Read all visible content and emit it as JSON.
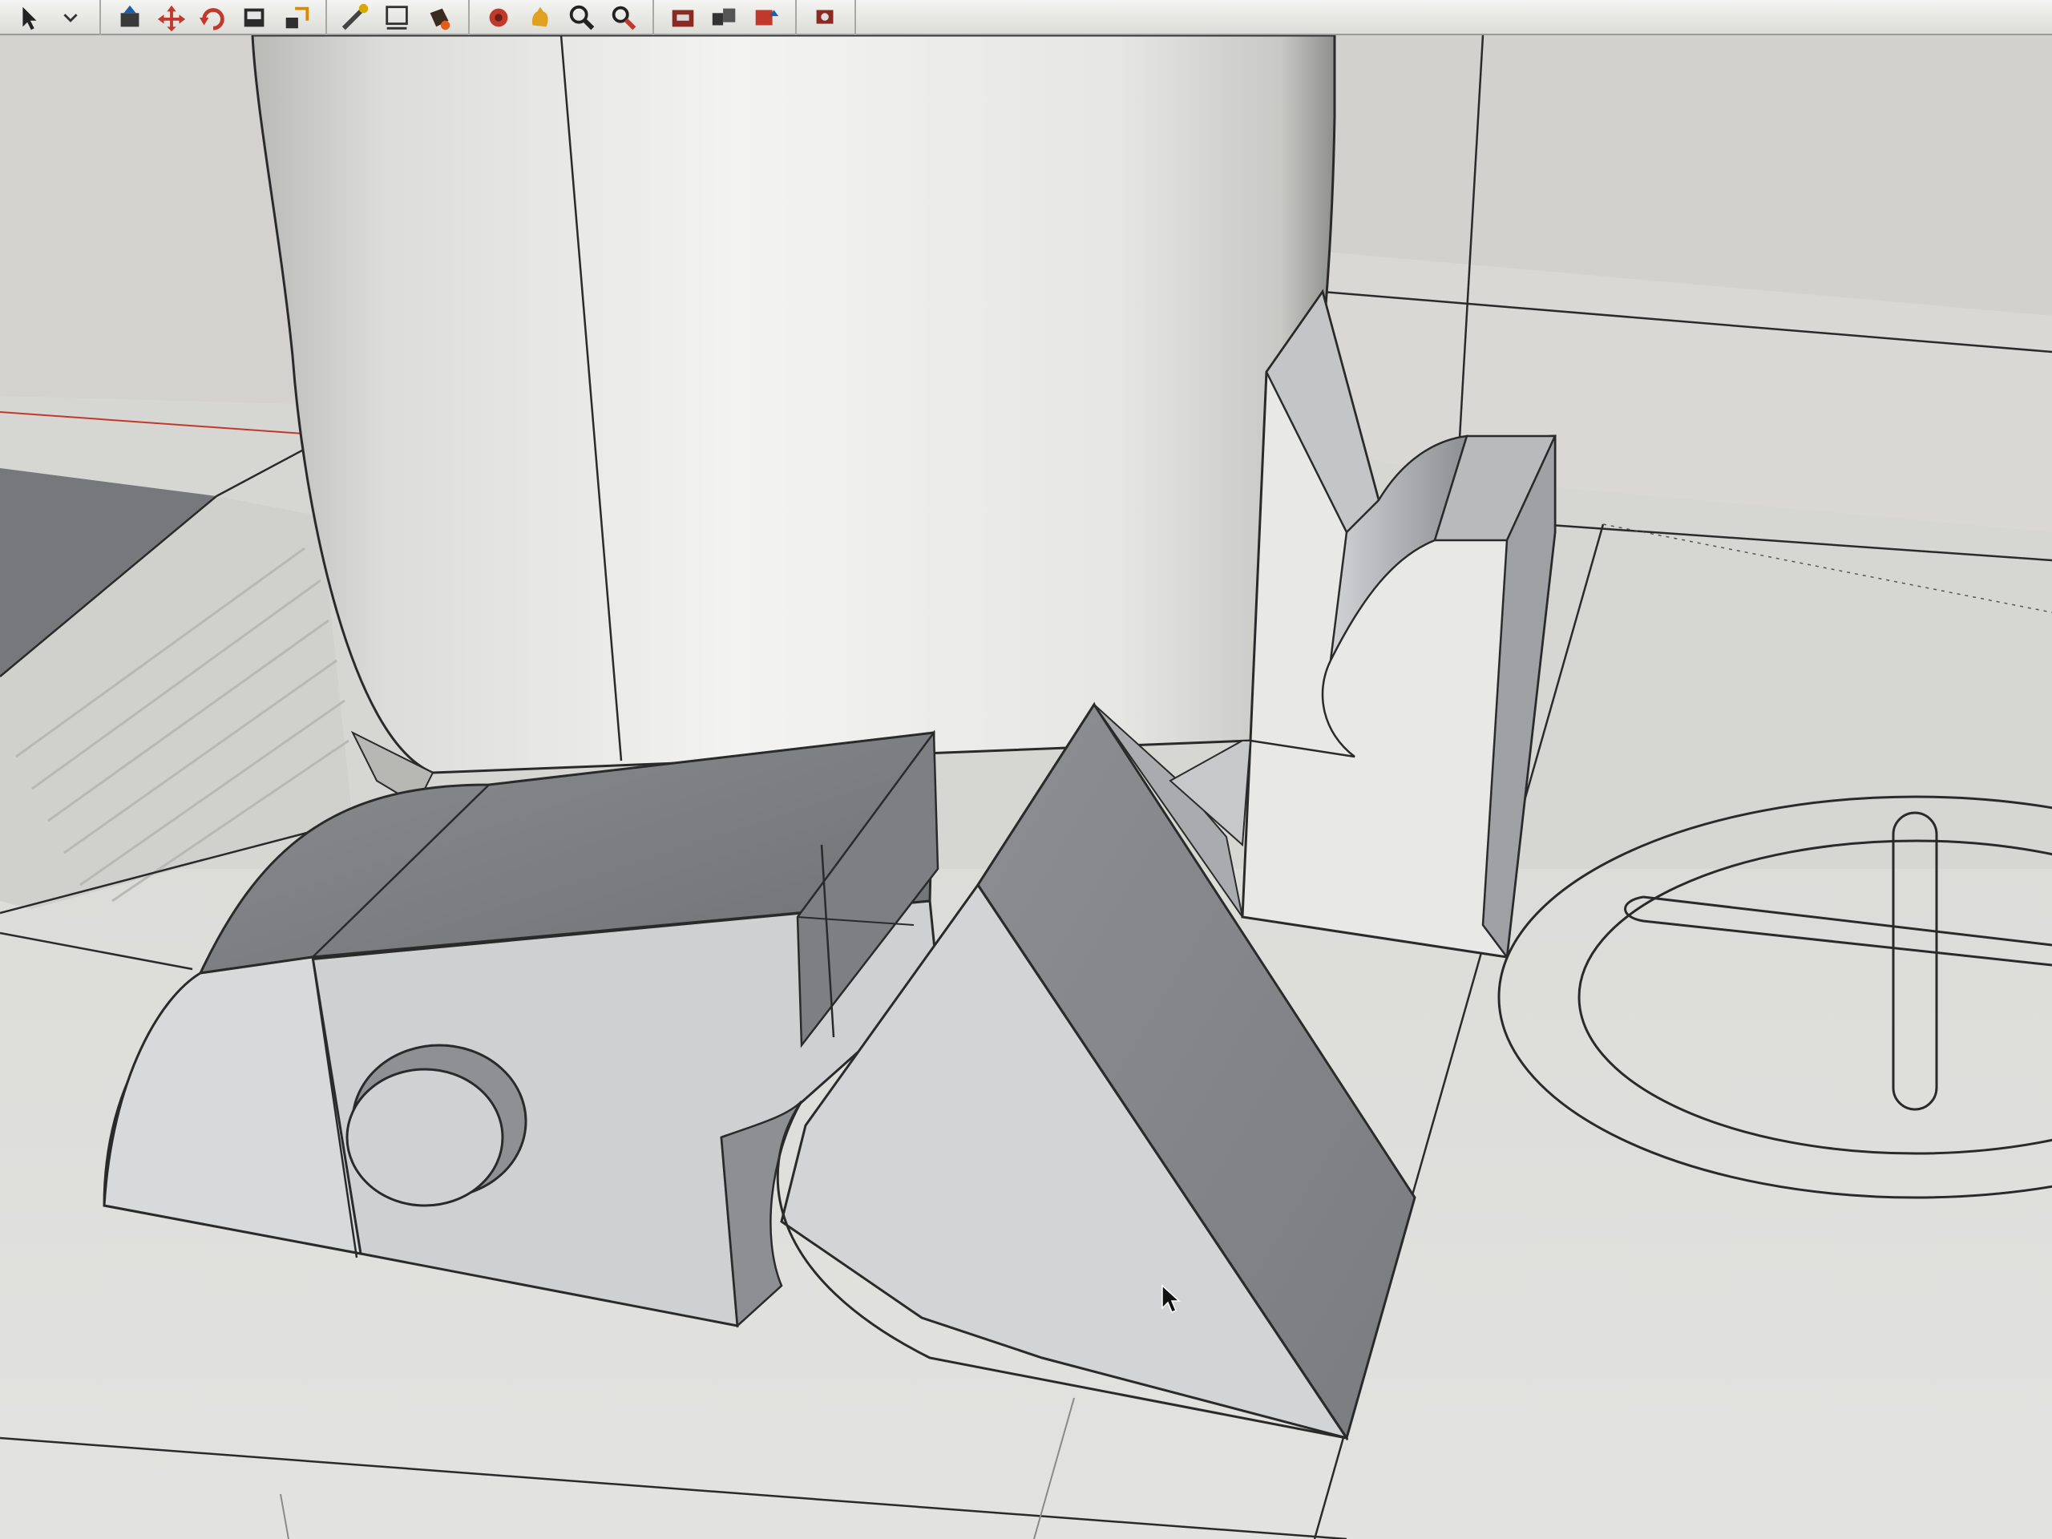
{
  "app": {
    "window_title": "",
    "accent_color": "#c0392b"
  },
  "toolbar": {
    "groups": [
      {
        "tools": [
          {
            "icon": "select-arrow-icon"
          },
          {
            "icon": "dropdown-chevron-icon"
          }
        ]
      },
      {
        "tools": [
          {
            "icon": "push-pull-icon"
          },
          {
            "icon": "move-icon"
          },
          {
            "icon": "rotate-icon"
          },
          {
            "icon": "follow-me-icon"
          },
          {
            "icon": "scale-icon"
          }
        ]
      },
      {
        "tools": [
          {
            "icon": "tape-measure-icon"
          },
          {
            "icon": "dimension-icon"
          },
          {
            "icon": "paint-bucket-icon"
          }
        ]
      },
      {
        "tools": [
          {
            "icon": "orbit-icon"
          },
          {
            "icon": "pan-icon"
          },
          {
            "icon": "zoom-icon"
          },
          {
            "icon": "zoom-extents-icon"
          }
        ]
      },
      {
        "tools": [
          {
            "icon": "warehouse-icon"
          },
          {
            "icon": "components-icon"
          },
          {
            "icon": "share-model-icon"
          }
        ]
      },
      {
        "tools": [
          {
            "icon": "extension-warehouse-icon"
          }
        ]
      }
    ]
  },
  "viewport": {
    "background_color": "#e4e4e2",
    "ground_color": "#dcdcd9",
    "red_axis_color": "#c0392b",
    "model_objects": [
      {
        "name": "cylinder"
      },
      {
        "name": "curved-block-with-hole"
      },
      {
        "name": "triangular-wedge"
      },
      {
        "name": "tall-curved-block"
      },
      {
        "name": "plus-circle-sketch"
      }
    ]
  },
  "cursor": {
    "icon": "mouse-pointer-icon"
  }
}
